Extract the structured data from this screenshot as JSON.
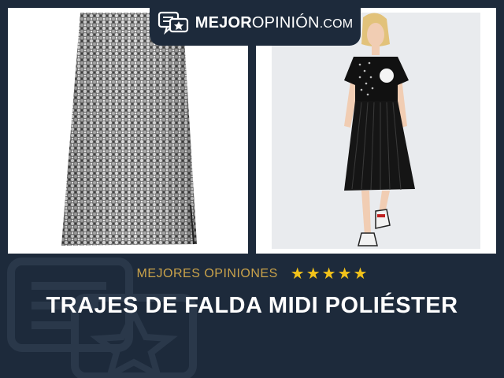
{
  "logo": {
    "brand_bold": "MEJOR",
    "brand_regular": "OPINIÓN",
    "domain": ".COM",
    "icon": "review-bubble-icon"
  },
  "rating": {
    "label": "MEJORES OPINIONES",
    "stars": 5,
    "star_color": "#f2c21a"
  },
  "title": "TRAJES DE FALDA MIDI POLIÉSTER",
  "colors": {
    "background": "#1d2a3b",
    "label": "#c9a24a",
    "panel": "#ffffff"
  }
}
